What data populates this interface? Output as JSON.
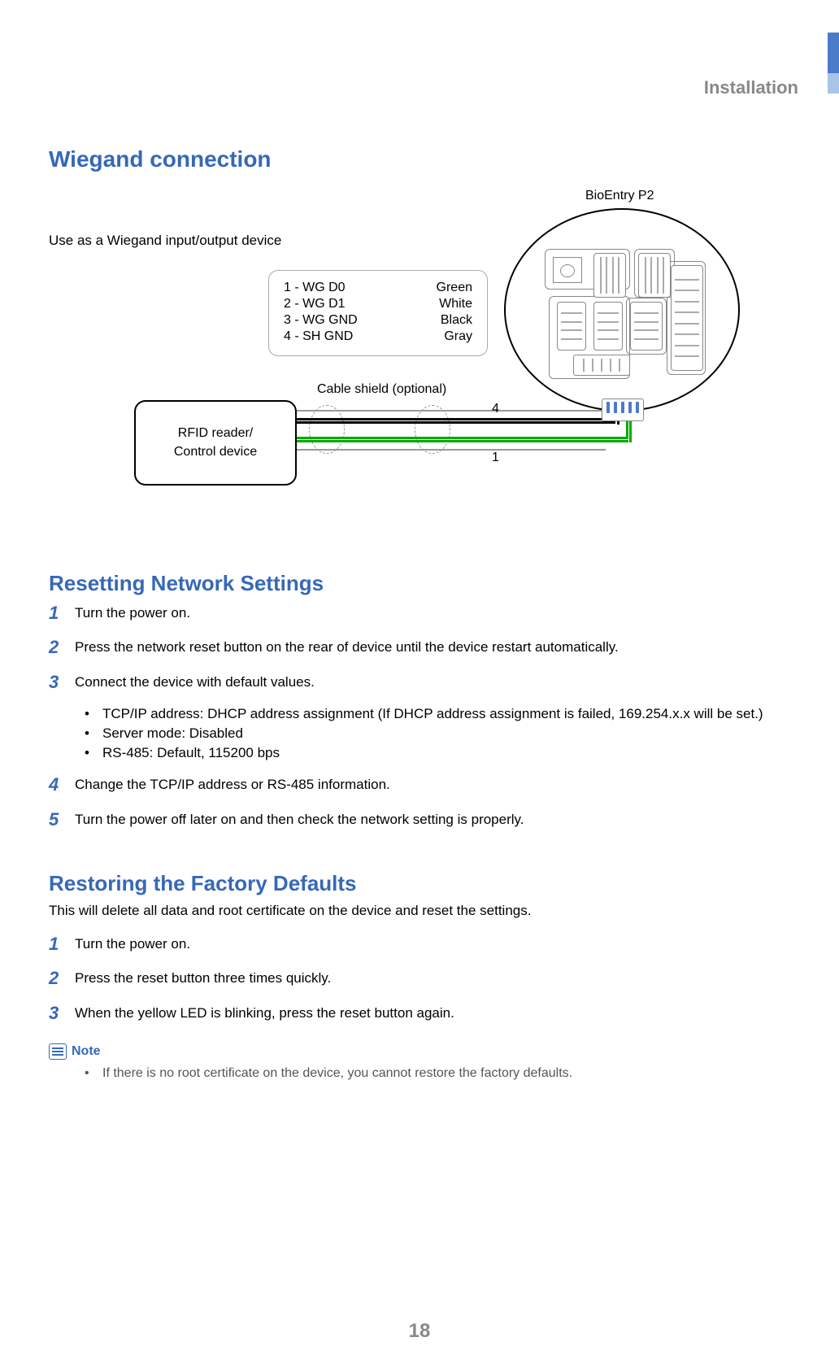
{
  "chapter": "Installation",
  "section1_title": "Wiegand connection",
  "diagram": {
    "use_label": "Use  as  a  Wiegand  input/output device",
    "device_label": "BioEntry  P2",
    "pins": [
      {
        "num": "1 -",
        "name": "WG  D0",
        "color": "Green"
      },
      {
        "num": "2 -",
        "name": "WG  D1",
        "color": "White"
      },
      {
        "num": "3 -",
        "name": "WG  GND",
        "color": "Black"
      },
      {
        "num": "4 -",
        "name": "SH  GND",
        "color": "Gray"
      }
    ],
    "cable_label": "Cable  shield  (optional)",
    "rfid_label": "RFID  reader/\nControl  device",
    "wire_top": "4",
    "wire_bottom": "1"
  },
  "section2": {
    "title": "Resetting Network Settings",
    "steps": [
      "Turn the power on.",
      "Press the network reset button on the rear of device until the device restart automatically.",
      "Connect the device with default values.",
      "Change the TCP/IP address or RS-485 information.",
      "Turn the power off later on and then check the network setting is properly."
    ],
    "defaults": [
      "TCP/IP address: DHCP address assignment (If DHCP address assignment is failed, 169.254.x.x will be set.)",
      "Server mode: Disabled",
      "RS-485: Default, 115200 bps"
    ]
  },
  "section3": {
    "title": "Restoring the Factory Defaults",
    "intro": "This will delete all data and root certificate on the device and reset the settings.",
    "steps": [
      "Turn the power on.",
      "Press the reset button three times quickly.",
      "When the yellow LED is blinking, press the reset button again."
    ]
  },
  "note": {
    "label": "Note",
    "items": [
      "If there is no root certificate on the device, you cannot restore the factory defaults."
    ]
  },
  "page_number": "18"
}
